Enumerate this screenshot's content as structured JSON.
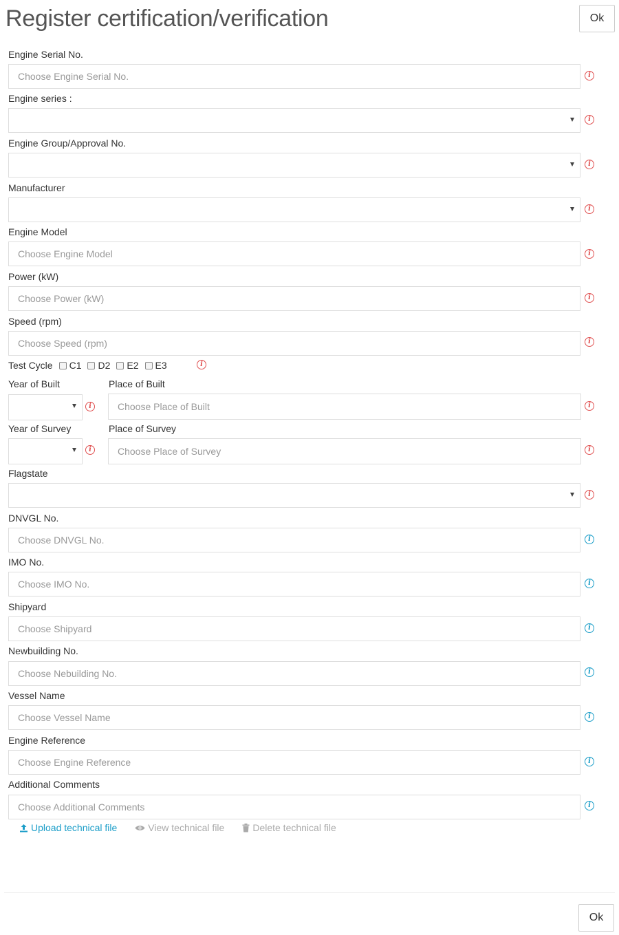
{
  "dialog": {
    "title": "Register certification/verification",
    "ok_label": "Ok"
  },
  "fields": {
    "engine_serial": {
      "label": "Engine Serial No.",
      "placeholder": "Choose Engine Serial No."
    },
    "engine_series": {
      "label": "Engine series :"
    },
    "engine_group": {
      "label": "Engine Group/Approval No."
    },
    "manufacturer": {
      "label": "Manufacturer"
    },
    "engine_model": {
      "label": "Engine Model",
      "placeholder": "Choose Engine Model"
    },
    "power": {
      "label": "Power (kW)",
      "placeholder": "Choose Power (kW)"
    },
    "speed": {
      "label": "Speed (rpm)",
      "placeholder": "Choose Speed (rpm)"
    },
    "test_cycle": {
      "label": "Test Cycle",
      "options": [
        "C1",
        "D2",
        "E2",
        "E3"
      ]
    },
    "year_built": {
      "label": "Year of Built"
    },
    "place_built": {
      "label": "Place of Built",
      "placeholder": "Choose Place of Built"
    },
    "year_survey": {
      "label": "Year of Survey"
    },
    "place_survey": {
      "label": "Place of Survey",
      "placeholder": "Choose Place of Survey"
    },
    "flagstate": {
      "label": "Flagstate"
    },
    "dnvgl_no": {
      "label": "DNVGL No.",
      "placeholder": "Choose DNVGL No."
    },
    "imo_no": {
      "label": "IMO No.",
      "placeholder": "Choose IMO No."
    },
    "shipyard": {
      "label": "Shipyard",
      "placeholder": "Choose Shipyard"
    },
    "newbuilding_no": {
      "label": "Newbuilding No.",
      "placeholder": "Choose Nebuilding No."
    },
    "vessel_name": {
      "label": "Vessel Name",
      "placeholder": "Choose Vessel Name"
    },
    "engine_reference": {
      "label": "Engine Reference",
      "placeholder": "Choose Engine Reference"
    },
    "additional_comments": {
      "label": "Additional Comments",
      "placeholder": "Choose Additional Comments"
    }
  },
  "file_actions": {
    "upload": "Upload technical file",
    "view": "View technical file",
    "delete": "Delete technical file"
  },
  "colors": {
    "required_icon": "#e05050",
    "optional_icon": "#1a9dc8",
    "link": "#1a9dc8",
    "disabled": "#aaaaaa"
  }
}
